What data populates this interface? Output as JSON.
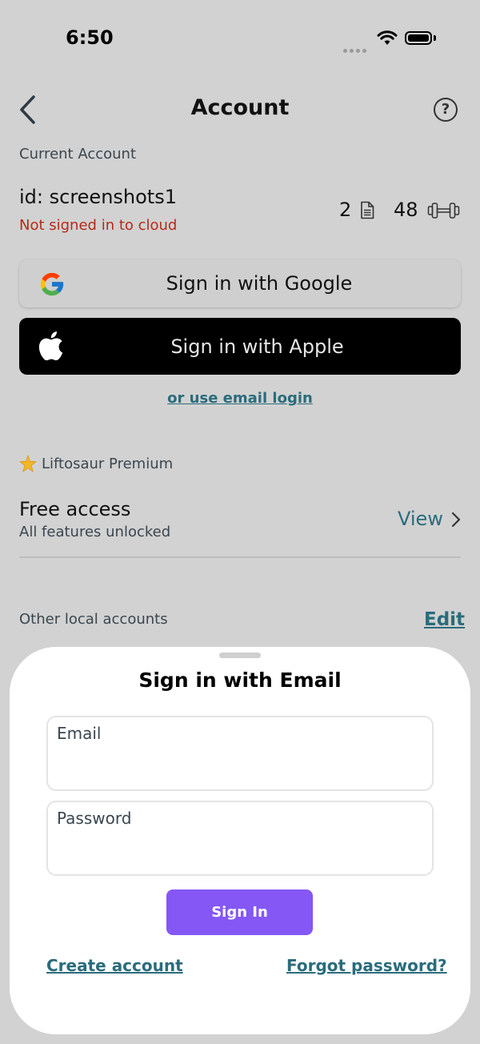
{
  "status_bar": {
    "time": "6:50"
  },
  "header": {
    "title": "Account",
    "help_glyph": "?"
  },
  "current_account": {
    "section_label": "Current Account",
    "id_text": "id: screenshots1",
    "cloud_status": "Not signed in to cloud",
    "program_count": "2",
    "exercise_count": "48"
  },
  "auth": {
    "google_label": "Sign in with Google",
    "apple_label": "Sign in with Apple",
    "email_login_link": "or use email login"
  },
  "premium": {
    "section_label": "Liftosaur Premium",
    "plan_title": "Free access",
    "plan_subtitle": "All features unlocked",
    "view_label": "View"
  },
  "other_accounts": {
    "section_label": "Other local accounts",
    "edit_label": "Edit"
  },
  "email_sheet": {
    "title": "Sign in with Email",
    "email_label": "Email",
    "email_value": "",
    "password_label": "Password",
    "password_value": "",
    "signin_label": "Sign In",
    "create_account_label": "Create account",
    "forgot_password_label": "Forgot password?"
  },
  "colors": {
    "accent_link": "#2a6c7c",
    "signin_button": "#8557f5",
    "error_text": "#b52a1a"
  }
}
